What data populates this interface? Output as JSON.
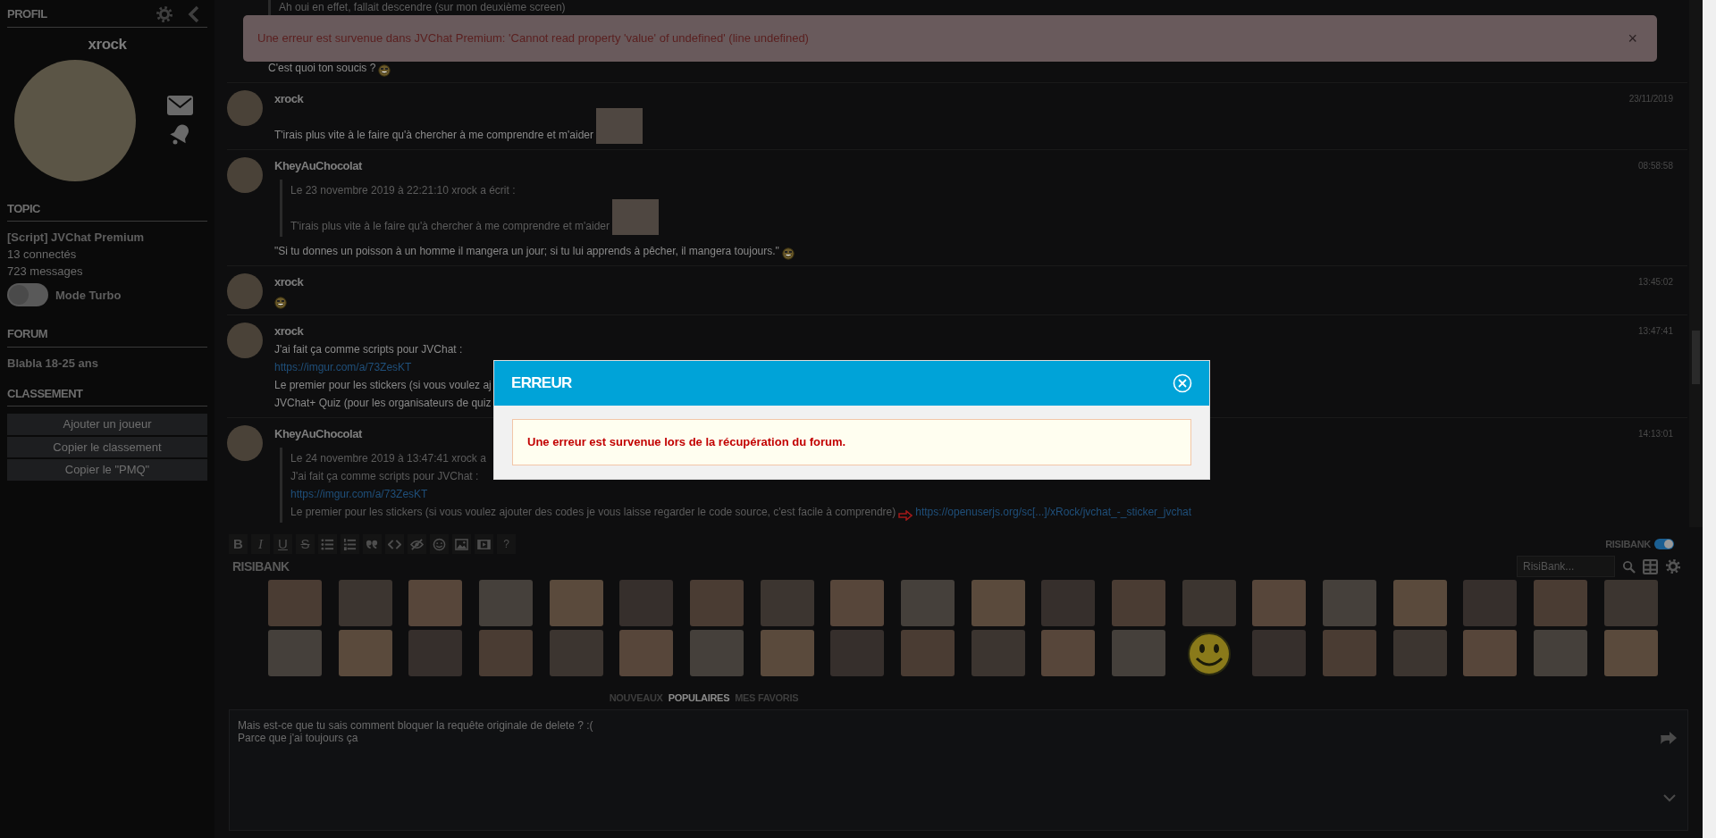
{
  "sidebar": {
    "profile_heading": "PROFIL",
    "username": "xrock",
    "topic_heading": "TOPIC",
    "topic_title": "[Script] JVChat Premium",
    "connected": "13 connectés",
    "messages_count": "723 messages",
    "turbo": {
      "label": "Mode Turbo",
      "on": false
    },
    "forum_heading": "FORUM",
    "forum_name": "Blabla 18-25 ans",
    "ranking_heading": "CLASSEMENT",
    "ranking_buttons": [
      "Ajouter un joueur",
      "Copier le classement",
      "Copier le \"PMQ\""
    ]
  },
  "messages": [
    {
      "quote": {
        "lines": [
          [
            {
              "kind": "text",
              "text": "Ah oui en effet, fallait descendre (sur mon deuxième screen)"
            }
          ]
        ]
      },
      "lines": [
        [
          {
            "kind": "text",
            "text": "C'est quoi ton soucis ?"
          },
          {
            "kind": "emoji"
          }
        ]
      ]
    },
    {
      "author": "xrock",
      "time": "23/11/2019",
      "lines": [
        [
          {
            "kind": "text",
            "text": "T'irais plus vite à le faire qu'à chercher à me comprendre et m'aider"
          },
          {
            "kind": "sticker"
          }
        ]
      ]
    },
    {
      "author": "KheyAuChocolat",
      "time": "08:58:58",
      "quote": {
        "header": "Le 23 novembre 2019 à 22:21:10 xrock a écrit :",
        "lines": [
          [
            {
              "kind": "text",
              "text": "T'irais plus vite à le faire qu'à chercher à me comprendre et m'aider"
            },
            {
              "kind": "sticker"
            }
          ]
        ]
      },
      "lines": [
        [
          {
            "kind": "text",
            "text": "\"Si tu donnes un poisson à un homme il mangera un jour; si tu lui apprends à pêcher, il mangera toujours.\""
          },
          {
            "kind": "emoji"
          }
        ]
      ]
    },
    {
      "author": "xrock",
      "time": "13:45:02",
      "lines": [
        [
          {
            "kind": "emoji"
          }
        ]
      ]
    },
    {
      "author": "xrock",
      "time": "13:47:41",
      "lines": [
        [
          {
            "kind": "text",
            "text": "J'ai fait ça comme scripts pour JVChat :"
          }
        ],
        [
          {
            "kind": "link",
            "text": "https://imgur.com/a/73ZesKT"
          }
        ],
        [
          {
            "kind": "text",
            "text": "Le premier pour les stickers (si vous voulez aj"
          }
        ],
        [
          {
            "kind": "text",
            "text": "JVChat+ Quiz (pour les organisateurs de quiz"
          }
        ]
      ]
    },
    {
      "author": "KheyAuChocolat",
      "time": "14:13:01",
      "quote": {
        "header": "Le 24 novembre 2019 à 13:47:41 xrock a",
        "lines": [
          [
            {
              "kind": "text",
              "text": "J'ai fait ça comme scripts pour JVChat :"
            }
          ],
          [
            {
              "kind": "link",
              "text": "https://imgur.com/a/73ZesKT"
            }
          ],
          [
            {
              "kind": "text",
              "text": "Le premier pour les stickers (si vous voulez ajouter des codes je vous laisse regarder le code source, c'est facile à comprendre)"
            },
            {
              "kind": "arrow"
            },
            {
              "kind": "link",
              "text": "https://openuserjs.org/sc[...]/xRock/jvchat_-_sticker_jvchat"
            }
          ]
        ]
      }
    }
  ],
  "toast": {
    "text": "Une erreur est survenue dans JVChat Premium: 'Cannot read property 'value' of undefined' (line undefined)",
    "close": "×"
  },
  "editor": {
    "toolbar": [
      {
        "kind": "bold",
        "label": "B"
      },
      {
        "kind": "italic",
        "label": "I"
      },
      {
        "kind": "underline",
        "label": "U"
      },
      {
        "kind": "strike",
        "label": "S"
      },
      {
        "kind": "bullets"
      },
      {
        "kind": "numbers"
      },
      {
        "kind": "quote"
      },
      {
        "kind": "code"
      },
      {
        "kind": "spoiler"
      },
      {
        "kind": "smiley"
      },
      {
        "kind": "image"
      },
      {
        "kind": "video"
      },
      {
        "kind": "help",
        "label": "?"
      }
    ],
    "risibank_toggle": {
      "label": "RISIBANK",
      "on": true
    },
    "logo": "RISIBANK",
    "search": {
      "placeholder": "RisiBank..."
    },
    "stickers": [
      [
        {
          "kind": "photo"
        },
        {
          "kind": "photo"
        },
        {
          "kind": "photo"
        },
        {
          "kind": "photo"
        },
        {
          "kind": "photo"
        },
        {
          "kind": "photo"
        },
        {
          "kind": "photo"
        },
        {
          "kind": "photo"
        },
        {
          "kind": "photo"
        },
        {
          "kind": "photo"
        },
        {
          "kind": "photo"
        },
        {
          "kind": "photo"
        },
        {
          "kind": "photo"
        },
        {
          "kind": "photo"
        },
        {
          "kind": "photo"
        },
        {
          "kind": "photo"
        },
        {
          "kind": "photo"
        },
        {
          "kind": "photo"
        },
        {
          "kind": "photo"
        },
        {
          "kind": "photo"
        }
      ],
      [
        {
          "kind": "photo"
        },
        {
          "kind": "photo"
        },
        {
          "kind": "photo"
        },
        {
          "kind": "photo"
        },
        {
          "kind": "photo"
        },
        {
          "kind": "photo"
        },
        {
          "kind": "photo"
        },
        {
          "kind": "photo"
        },
        {
          "kind": "photo"
        },
        {
          "kind": "photo"
        },
        {
          "kind": "photo"
        },
        {
          "kind": "photo"
        },
        {
          "kind": "photo"
        },
        {
          "kind": "smiley"
        },
        {
          "kind": "photo"
        },
        {
          "kind": "photo"
        },
        {
          "kind": "photo"
        },
        {
          "kind": "photo"
        },
        {
          "kind": "photo"
        },
        {
          "kind": "photo"
        }
      ]
    ],
    "tabs": [
      {
        "label": "NOUVEAUX",
        "selected": false
      },
      {
        "label": "POPULAIRES",
        "selected": true
      },
      {
        "label": "MES FAVORIS",
        "selected": false
      }
    ],
    "draft": "Mais est-ce que tu sais comment bloquer la requête originale de delete ? :(\nParce que j'ai toujours ça"
  },
  "modal": {
    "title": "ERREUR",
    "message": "Une erreur est survenue lors de la récupération du forum."
  }
}
